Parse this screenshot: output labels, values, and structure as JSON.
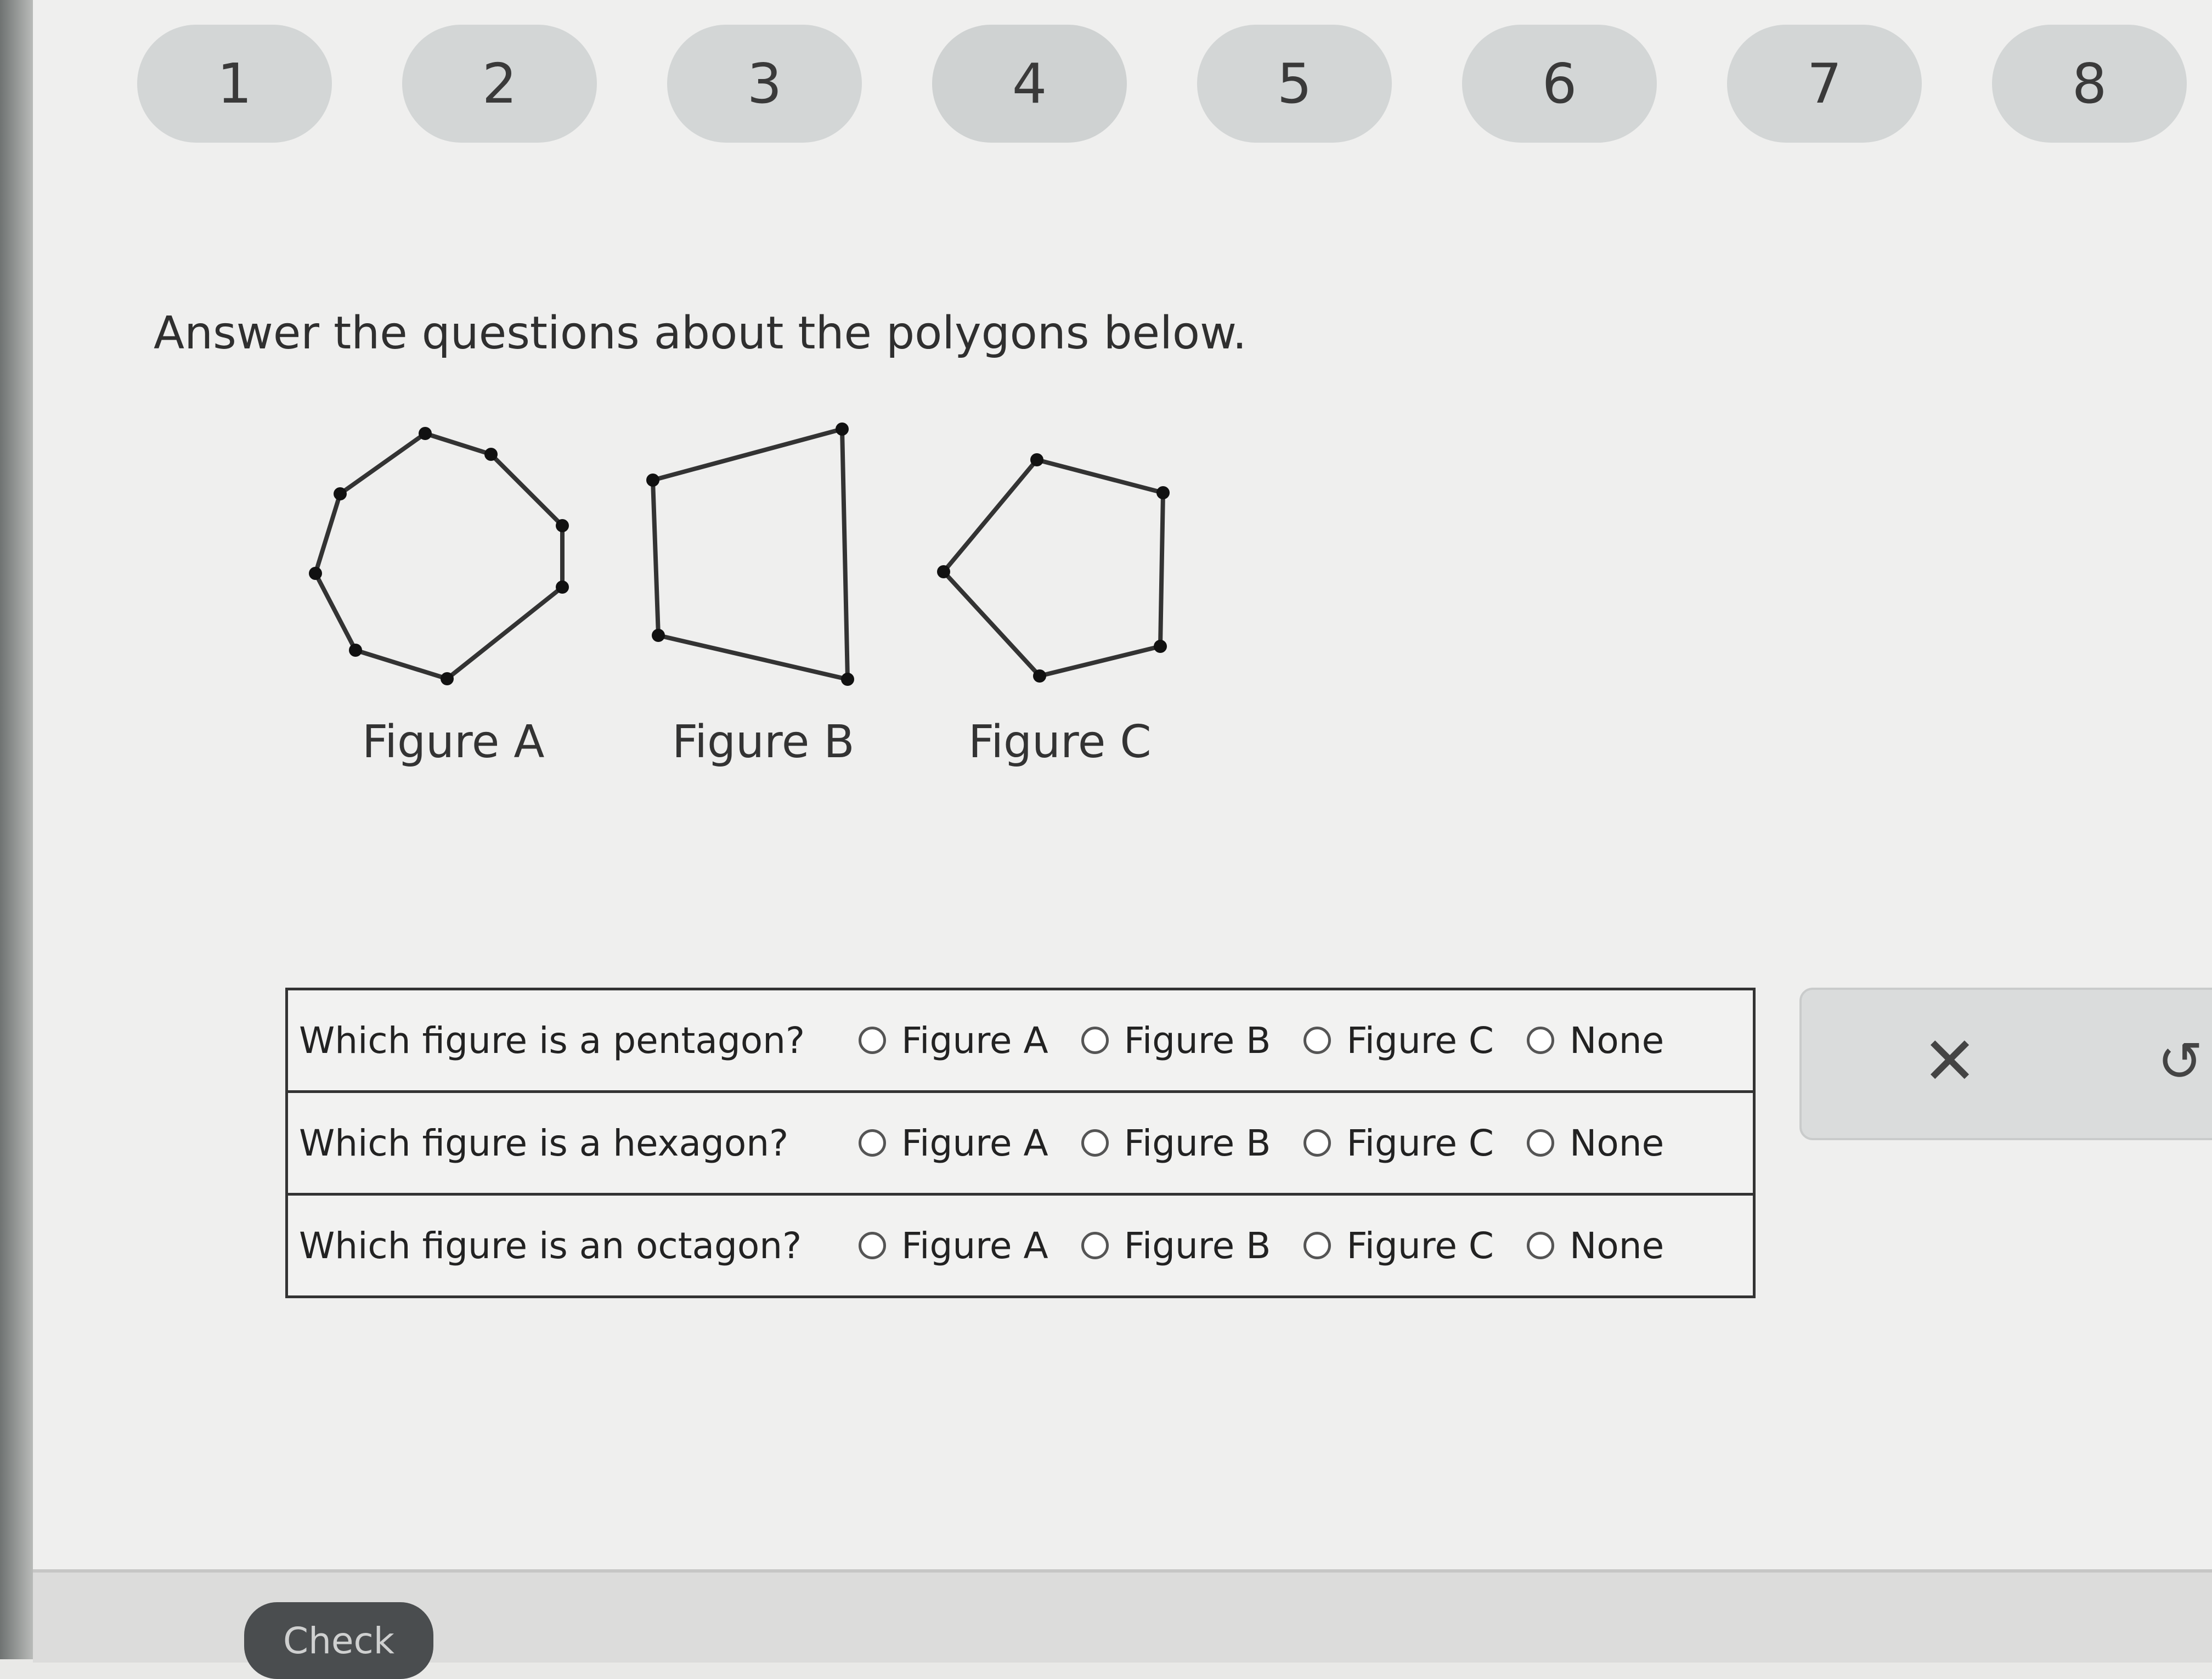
{
  "steps": [
    "1",
    "2",
    "3",
    "4",
    "5",
    "6",
    "7",
    "8"
  ],
  "instruction": "Answer the questions about the polygons below.",
  "figures": [
    {
      "label": "Figure A"
    },
    {
      "label": "Figure B"
    },
    {
      "label": "Figure C"
    }
  ],
  "questions": [
    {
      "text": "Which figure is a pentagon?",
      "options": [
        "Figure A",
        "Figure B",
        "Figure C",
        "None"
      ]
    },
    {
      "text": "Which figure is a hexagon?",
      "options": [
        "Figure A",
        "Figure B",
        "Figure C",
        "None"
      ]
    },
    {
      "text": "Which figure is an octagon?",
      "options": [
        "Figure A",
        "Figure B",
        "Figure C",
        "None"
      ]
    }
  ],
  "tools": {
    "clear_icon": "close-icon",
    "undo_icon": "undo-icon"
  },
  "check_label": "Check"
}
